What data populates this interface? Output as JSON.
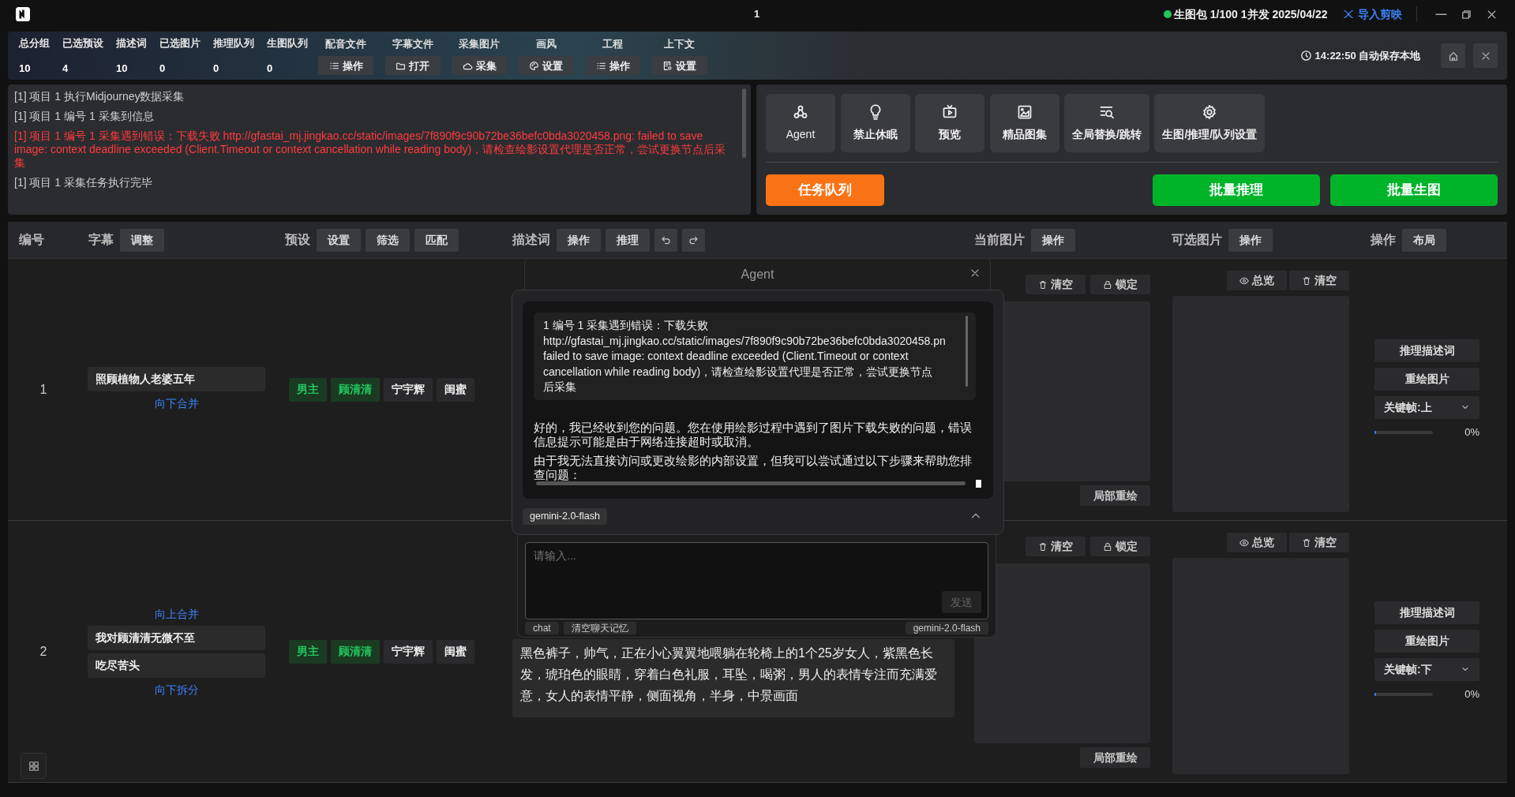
{
  "title_bar": {
    "page": "1",
    "status": "生图包 1/100 1并发 2025/04/22",
    "import_link": "导入剪映"
  },
  "stats": [
    {
      "label": "总分组",
      "value": "10"
    },
    {
      "label": "已选预设",
      "value": "4"
    },
    {
      "label": "描述词",
      "value": "10"
    },
    {
      "label": "已选图片",
      "value": "0"
    },
    {
      "label": "推理队列",
      "value": "0"
    },
    {
      "label": "生图队列",
      "value": "0"
    }
  ],
  "tool_groups": [
    {
      "label": "配音文件",
      "button": "操作"
    },
    {
      "label": "字幕文件",
      "button": "打开"
    },
    {
      "label": "采集图片",
      "button": "采集"
    },
    {
      "label": "画风",
      "button": "设置"
    },
    {
      "label": "工程",
      "button": "操作"
    },
    {
      "label": "上下文",
      "button": "设置"
    }
  ],
  "autosave": "14:22:50 自动保存本地",
  "log": [
    {
      "kind": "info",
      "text": "[1] 项目 1 执行Midjourney数据采集"
    },
    {
      "kind": "info",
      "text": "[1] 项目 1 编号 1 采集到信息"
    },
    {
      "kind": "error",
      "text": "[1] 项目 1 编号 1 采集遇到错误：下载失败 http://gfastai_mj.jingkao.cc/static/images/7f890f9c90b72be36befc0bda3020458.png: failed to save image: context deadline exceeded (Client.Timeout or context cancellation while reading body)，请检查绘影设置代理是否正常，尝试更换节点后采集"
    },
    {
      "kind": "info",
      "text": "[1] 项目 1 采集任务执行完毕"
    }
  ],
  "tools": [
    {
      "label": "Agent"
    },
    {
      "label": "禁止休眠"
    },
    {
      "label": "预览"
    },
    {
      "label": "精品图集"
    },
    {
      "label": "全局替换/跳转"
    },
    {
      "label": "生图/推理/队列设置"
    }
  ],
  "task_queue_button": "任务队列",
  "batch_buttons": [
    "批量推理",
    "批量生图"
  ],
  "table": {
    "columns": [
      {
        "label": "编号"
      },
      {
        "label": "字幕",
        "buttons": [
          "调整"
        ]
      },
      {
        "label": "预设",
        "buttons": [
          "设置",
          "筛选",
          "匹配"
        ]
      },
      {
        "label": "描述词",
        "buttons": [
          "操作",
          "推理"
        ],
        "history": true
      },
      {
        "label": "当前图片",
        "buttons": [
          "操作"
        ]
      },
      {
        "label": "可选图片",
        "buttons": [
          "操作"
        ]
      },
      {
        "label": "操作",
        "buttons": [
          "布局"
        ]
      }
    ],
    "rows": [
      {
        "number": "1",
        "subtitles": [
          "照顾植物人老婆五年"
        ],
        "link_below": "向下合并",
        "tags": [
          {
            "label": "男主",
            "selected": true
          },
          {
            "label": "顾清清",
            "selected": true
          },
          {
            "label": "宁宇辉",
            "selected": false
          },
          {
            "label": "闺蜜",
            "selected": false
          }
        ],
        "current_buttons": [
          "清空",
          "锁定"
        ],
        "redraw": "局部重绘",
        "optional_buttons": [
          "总览",
          "清空"
        ],
        "actions": [
          "推理描述词",
          "重绘图片"
        ],
        "keyframe": "关键帧:上",
        "progress": {
          "level": 0,
          "reading": "0%"
        }
      },
      {
        "number": "2",
        "link_above": "向上合并",
        "subtitles": [
          "我对顾清清无微不至",
          "吃尽苦头"
        ],
        "link_below": "向下拆分",
        "tags": [
          {
            "label": "男主",
            "selected": true
          },
          {
            "label": "顾清清",
            "selected": true
          },
          {
            "label": "宁宇辉",
            "selected": false
          },
          {
            "label": "闺蜜",
            "selected": false
          }
        ],
        "description": "黑色裤子，帅气，正在小心翼翼地喂躺在轮椅上的1个25岁女人，紫黑色长发，琥珀色的眼睛，穿着白色礼服，耳坠，喝粥，男人的表情专注而充满爱意，女人的表情平静，侧面视角，半身，中景画面",
        "current_buttons": [
          "清空",
          "锁定"
        ],
        "redraw": "局部重绘",
        "optional_buttons": [
          "总览",
          "清空"
        ],
        "actions": [
          "推理描述词",
          "重绘图片"
        ],
        "keyframe": "关键帧:下",
        "progress": {
          "level": 0,
          "reading": "0%"
        }
      }
    ]
  },
  "agent": {
    "title": "Agent",
    "user_message": [
      "1 编号 1 采集遇到错误：下载失败",
      "http://gfastai_mj.jingkao.cc/static/images/7f890f9c90b72be36befc0bda3020458.pn",
      "failed to save image: context deadline exceeded (Client.Timeout or context",
      "cancellation while reading body)，请检查绘影设置代理是否正常，尝试更换节点",
      "后采集"
    ],
    "reply": [
      "好的，我已经收到您的问题。您在使用绘影过程中遇到了图片下载失败的问题，错误信息提示可能是由于网络连接超时或取消。",
      "由于我无法直接访问或更改绘影的内部设置，但我可以尝试通过以下步骤来帮助您排查问题："
    ],
    "model": "gemini-2.0-flash",
    "placeholder": "请输入...",
    "send": {
      "label": "发送",
      "disabled": true
    },
    "tags": [
      "chat",
      "清空聊天记忆"
    ],
    "model_label": "gemini-2.0-flash"
  }
}
